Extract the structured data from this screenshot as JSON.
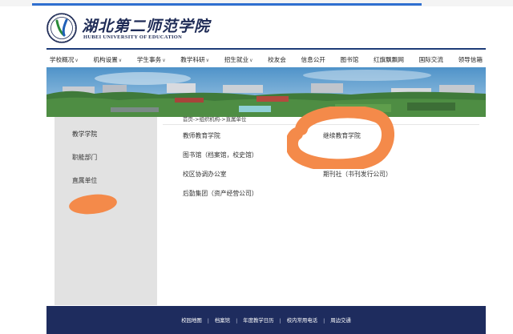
{
  "header": {
    "school_name_cn": "湖北第二师范学院",
    "school_name_en": "HUBEI UNIVERSITY OF EDUCATION"
  },
  "nav": {
    "items": [
      {
        "label": "学校概况",
        "caret": "∨"
      },
      {
        "label": "机构设置",
        "caret": "∨"
      },
      {
        "label": "学生事务",
        "caret": "∨"
      },
      {
        "label": "教学科研",
        "caret": "∨"
      },
      {
        "label": "招生就业",
        "caret": "∨"
      },
      {
        "label": "校友会",
        "caret": ""
      },
      {
        "label": "信息公开",
        "caret": ""
      },
      {
        "label": "图书馆",
        "caret": ""
      },
      {
        "label": "红旗飘飘网",
        "caret": ""
      },
      {
        "label": "国际交流",
        "caret": ""
      },
      {
        "label": "领导信箱",
        "caret": ""
      }
    ]
  },
  "sidebar": {
    "items": [
      {
        "label": "教学学院"
      },
      {
        "label": "职能部门"
      },
      {
        "label": "直属单位"
      }
    ]
  },
  "main": {
    "breadcrumb": "首页->组织机构->直属单位",
    "units": [
      {
        "label": "教师教育学院"
      },
      {
        "label": "继续教育学院"
      },
      {
        "label": "图书馆（档案馆，校史馆）"
      },
      {
        "label": "校区协调办公室"
      },
      {
        "label": "期刊社（书刊发行公司）"
      },
      {
        "label": "后勤集团（资产经营公司）"
      }
    ]
  },
  "footer": {
    "links": [
      {
        "label": "校园地图"
      },
      {
        "label": "档案馆"
      },
      {
        "label": "年度教学日历"
      },
      {
        "label": "校内常用电话"
      },
      {
        "label": "周边交通"
      }
    ],
    "separator": "|"
  },
  "colors": {
    "brand_navy": "#1e2c5e",
    "accent_blue": "#2f6fd0",
    "sidebar_gray": "#e2e2e2",
    "annotation_orange": "#f48a4a"
  }
}
